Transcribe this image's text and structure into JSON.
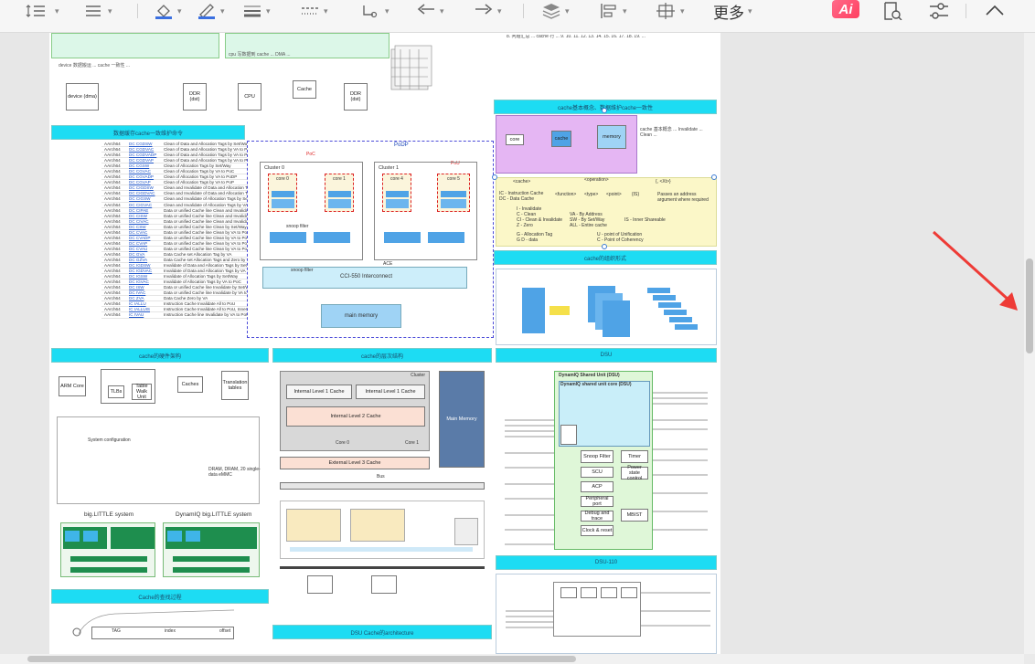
{
  "toolbar": {
    "more_label": "更多",
    "ai_label": "Ai",
    "icons": [
      "line-spacing-icon",
      "align-icon",
      "fill-color-icon",
      "line-color-icon",
      "line-width-icon",
      "dash-style-icon",
      "connector-icon",
      "arrow-start-icon",
      "arrow-end-icon",
      "layer-icon",
      "align-shapes-icon",
      "position-icon",
      "ai-icon",
      "search-document-icon",
      "settings-sliders-icon",
      "collapse-icon"
    ]
  },
  "diagrams": {
    "left_panel_title": "数据缓存cache一致维护命令",
    "cache_table": [
      {
        "a": "AArch64",
        "op": "DC CGDSW",
        "desc": "Clean of Data and Allocation Tags by Set/Way"
      },
      {
        "a": "AArch64",
        "op": "DC CGDVAC",
        "desc": "Clean of Data and Allocation Tags by VA to PoC"
      },
      {
        "a": "AArch64",
        "op": "DC CGDVADP",
        "desc": "Clean of Data and Allocation Tags by VA to PoDP"
      },
      {
        "a": "AArch64",
        "op": "DC CGDVAP",
        "desc": "Clean of Data and Allocation Tags by VA to PoP"
      },
      {
        "a": "AArch64",
        "op": "DC CGSW",
        "desc": "Clean of Allocation Tags by Set/Way"
      },
      {
        "a": "AArch64",
        "op": "DC CGVAC",
        "desc": "Clean of Allocation Tags by VA to PoC"
      },
      {
        "a": "AArch64",
        "op": "DC CGVADP",
        "desc": "Clean of Allocation Tags by VA to PoDP"
      },
      {
        "a": "AArch64",
        "op": "DC CGVAP",
        "desc": "Clean of Allocation Tags by VA to PoP"
      },
      {
        "a": "AArch64",
        "op": "DC CIGDSW",
        "desc": "Clean and Invalidate of Data and Allocation Tags by Set/Way"
      },
      {
        "a": "AArch64",
        "op": "DC CIGDVAC",
        "desc": "Clean and Invalidate of Data and Allocation Tags by VA to PoC"
      },
      {
        "a": "AArch64",
        "op": "DC CIGSW",
        "desc": "Clean and Invalidate of Allocation Tags by Set/Way"
      },
      {
        "a": "AArch64",
        "op": "DC CIGVAC",
        "desc": "Clean and Invalidate of Allocation Tags by VA to PoC"
      },
      {
        "a": "AArch64",
        "op": "DC CIPAE",
        "desc": "Data or unified Cache line Clean and Invalidate by PA to PoE"
      },
      {
        "a": "AArch64",
        "op": "DC CISW",
        "desc": "Data or unified Cache line Clean and Invalidate by Set/Way"
      },
      {
        "a": "AArch64",
        "op": "DC CIVAC",
        "desc": "Data or unified Cache line Clean and Invalidate by VA to PoC"
      },
      {
        "a": "AArch64",
        "op": "DC CSW",
        "desc": "Data or unified Cache line Clean by Set/Way"
      },
      {
        "a": "AArch64",
        "op": "DC CVAC",
        "desc": "Data or unified Cache line Clean by VA to PoC"
      },
      {
        "a": "AArch64",
        "op": "DC CVADP",
        "desc": "Data or unified Cache line Clean by VA to PoDP"
      },
      {
        "a": "AArch64",
        "op": "DC CVAP",
        "desc": "Data or unified Cache line Clean by VA to PoP"
      },
      {
        "a": "AArch64",
        "op": "DC CVAU",
        "desc": "Data or unified Cache line Clean by VA to PoU"
      },
      {
        "a": "AArch64",
        "op": "DC GVA",
        "desc": "Data Cache set Allocation Tag by VA"
      },
      {
        "a": "AArch64",
        "op": "DC GZVA",
        "desc": "Data Cache set Allocation Tags and Zero by VA"
      },
      {
        "a": "AArch64",
        "op": "DC IGDSW",
        "desc": "Invalidate of Data and Allocation Tags by Set/Way"
      },
      {
        "a": "AArch64",
        "op": "DC IGDVAC",
        "desc": "Invalidate of Data and Allocation Tags by VA to PoC"
      },
      {
        "a": "AArch64",
        "op": "DC IGSW",
        "desc": "Invalidate of Allocation Tags by Set/Way"
      },
      {
        "a": "AArch64",
        "op": "DC IGVAC",
        "desc": "Invalidate of Allocation Tags by VA to PoC"
      },
      {
        "a": "AArch64",
        "op": "DC ISW",
        "desc": "Data or unified Cache line Invalidate by Set/Way"
      },
      {
        "a": "AArch64",
        "op": "DC IVAC",
        "desc": "Data or unified Cache line Invalidate by VA to PoC"
      },
      {
        "a": "AArch64",
        "op": "DC ZVA",
        "desc": "Data Cache Zero by VA"
      },
      {
        "a": "AArch64",
        "op": "IC IALLU",
        "desc": "Instruction Cache Invalidate All to PoU"
      },
      {
        "a": "AArch64",
        "op": "IC IALLUIS",
        "desc": "Instruction Cache Invalidate All to PoU, Inner Shareable"
      },
      {
        "a": "AArch64",
        "op": "IC IVAU",
        "desc": "Instruction Cache line Invalidate by VA to PoU"
      }
    ],
    "podp": {
      "title": "PoDP",
      "poc": "PoC",
      "pou": "PoU",
      "cluster0": "Cluster 0",
      "cluster1": "Cluster 1",
      "core0": "core 0",
      "core1": "core 1",
      "core4": "core 4",
      "core5": "core 5",
      "mmu": "MMU",
      "snoop": "snoop filter",
      "l3": "L3 cache",
      "ace": "ACE",
      "snoop2": "snoop filter",
      "cci": "CCI-550 Interconnect",
      "mem": "main memory"
    },
    "cache_concept_band": "cache基本概念、数据维护cache一致性",
    "ops_legend": {
      "cache": "<cache>",
      "operation": "<operation>",
      "xt": "{, <Xt>}",
      "function": "<function>",
      "type": "<type>",
      "point": "<point>",
      "is": "{IS}",
      "ic": "IC - Instruction Cache",
      "dc": "DC - Data Cache",
      "i": "I - Invalidate",
      "c": "C - Clean",
      "ci": "CI - Clean & Invalidate",
      "z": "Z - Zero",
      "va": "VA - By Address",
      "sw": "SW - By Set/Way",
      "all": "ALL - Entire cache",
      "is_desc": "IS - Inner Shareable",
      "g": "G - Allocation Tag",
      "gd": "G D - data",
      "u": "U - point of Unification",
      "cpoc": "C - Point of Coherency",
      "xt_desc": "Passes an address argument where required"
    },
    "cache_org_band": "cache的组织形式",
    "cache_struct_band": "cache的硬件架构",
    "cache_arch_band": "cache的层次结构",
    "dsu_band": "DSU",
    "dsu110_band": "DSU-110",
    "cache_find_band": "Cache的查找过程",
    "dsu_arch_band": "DSU Cache的architecture",
    "hierarchy": {
      "arm_core": "ARM Core",
      "mmu": "MMU",
      "tlbs": "TLBs",
      "walk": "Table Walk Unit",
      "caches": "Caches",
      "memory": "Memory",
      "tables": "Translation tables",
      "virtual": "Virtual address",
      "physical": "Physical address",
      "address": "Address translation",
      "sysconf": "System configuration",
      "dram": "DRAM, DRAM, 20 single-data eMMC",
      "level4": "Level 4 (Main memory)",
      "disk": "disk",
      "biglittle": "big.LITTLE system",
      "dynamiq": "DynamIQ big.LITTLE system",
      "ilc1": "Internal Level 1 Cache",
      "ilc2": "Internal Level 1 Cache",
      "ilc3": "Internal Level 2 Cache",
      "core0": "Core 0",
      "core1": "Core 1",
      "cluster": "Cluster",
      "elc": "External Level 3 Cache",
      "bus": "Bus",
      "main_memory": "Main Memory",
      "tag": "TAG",
      "index": "index",
      "offset": "offset"
    },
    "dsu": {
      "title": "DynamIQ Shared Unit (DSU)",
      "l3": "DynamIQ shared unit core (DSU)",
      "irq": "Interrupts",
      "ace": "ACE or CHI",
      "scu": "SCU",
      "acp": "ACP",
      "peri": "Peripheral port",
      "snoop": "Snoop Filter",
      "power": "Power state control",
      "debug": "Debug and trace",
      "timer": "Timer",
      "clock": "Clock & reset",
      "mbist": "MBIST"
    }
  }
}
